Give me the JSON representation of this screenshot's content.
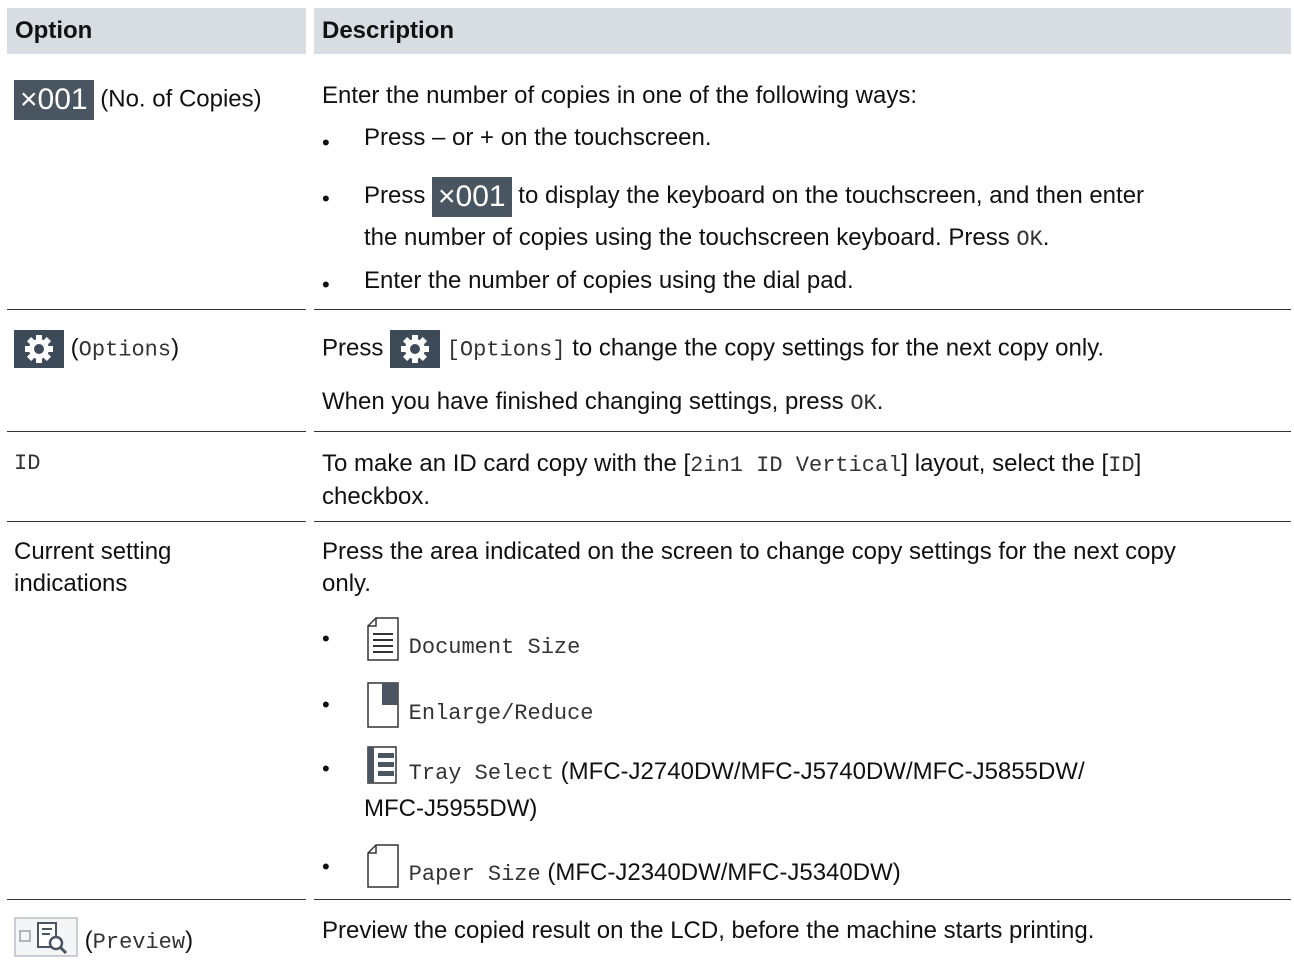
{
  "header": {
    "option": "Option",
    "description": "Description"
  },
  "rows": {
    "copies": {
      "badge": "×001",
      "label": "(No. of Copies)",
      "intro": "Enter the number of copies in one of the following ways:",
      "b1": "Press – or + on the touchscreen.",
      "b2_pre": "Press",
      "b2_post": "to display the keyboard on the touchscreen, and then enter",
      "b2_line2_pre": "the number of copies using the touchscreen keyboard. Press ",
      "b2_ok": "OK",
      "b2_end": ".",
      "b3": "Enter the number of copies using the dial pad."
    },
    "options": {
      "label_open": "(",
      "label": "Options",
      "label_close": ")",
      "desc_pre": "Press",
      "desc_bracket": "[Options]",
      "desc_post": "to change the copy settings for the next copy only.",
      "line2_pre": "When you have finished changing settings, press ",
      "line2_ok": "OK",
      "line2_end": "."
    },
    "id": {
      "label": "ID",
      "desc_a": "To make an ID card copy with the [",
      "desc_mono1": "2in1 ID Vertical",
      "desc_b": "] layout, select the [",
      "desc_mono2": "ID",
      "desc_c": "]",
      "desc_line2": "checkbox."
    },
    "current": {
      "label": "Current setting indications",
      "intro1": "Press the area indicated on the screen to change copy settings for the next copy",
      "intro2": "only.",
      "items": [
        {
          "name": "Document Size",
          "icon": "document-size-icon",
          "extra": ""
        },
        {
          "name": "Enlarge/Reduce",
          "icon": "enlarge-reduce-icon",
          "extra": ""
        },
        {
          "name": "Tray Select",
          "icon": "tray-select-icon",
          "extra": "(MFC-J2740DW/MFC-J5740DW/MFC-J5855DW/",
          "extra2": "MFC-J5955DW)"
        },
        {
          "name": "Paper Size",
          "icon": "paper-size-icon",
          "extra": "(MFC-J2340DW/MFC-J5340DW)"
        }
      ]
    },
    "preview": {
      "label_open": "(",
      "label": "Preview",
      "label_close": ")",
      "desc": "Preview the copied result on the LCD, before the machine starts printing."
    }
  }
}
